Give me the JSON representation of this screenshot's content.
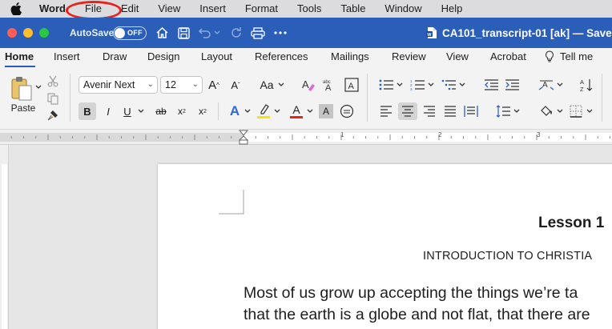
{
  "menubar": {
    "app_name": "Word",
    "items": [
      "File",
      "Edit",
      "View",
      "Insert",
      "Format",
      "Tools",
      "Table",
      "Window",
      "Help"
    ]
  },
  "titlebar": {
    "autosave_label": "AutoSave",
    "autosave_state": "OFF",
    "document_title": "CA101_transcript-01 [ak] — Saved",
    "traffic_lights": {
      "close": "#ff5f57",
      "minimize": "#febc2e",
      "zoom": "#28c840"
    },
    "accent": "#2b5eb8"
  },
  "tabs": {
    "items": [
      "Home",
      "Insert",
      "Draw",
      "Design",
      "Layout",
      "References",
      "Mailings",
      "Review",
      "View",
      "Acrobat"
    ],
    "active": "Home",
    "tell_me": "Tell me"
  },
  "ribbon": {
    "paste_label": "Paste",
    "font_name": "Avenir Next",
    "font_size": "12",
    "grow_font": "A",
    "shrink_font": "A",
    "change_case": "Aa",
    "bold": "B",
    "italic": "I",
    "underline": "U",
    "strikethrough": "ab",
    "subscript": "x",
    "superscript": "x",
    "text_effects": "A",
    "font_color": "A",
    "char_shading": "A",
    "highlight_color": "#f5e40b",
    "font_color_value": "#e8211b",
    "sort_label": "A"
  },
  "ruler": {
    "numbers": [
      "1",
      "2",
      "3"
    ]
  },
  "document": {
    "lesson_title": "Lesson 1",
    "subtitle": "INTRODUCTION TO CHRISTIA",
    "body_lines": [
      "Most of us grow up accepting the things we’re ta",
      "that the earth is a globe and not flat, that there are"
    ]
  }
}
